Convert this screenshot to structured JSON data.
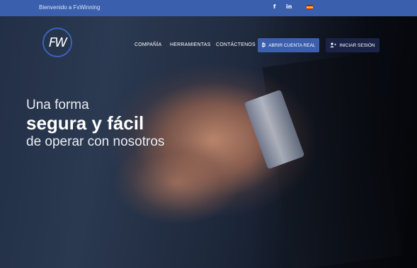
{
  "topbar": {
    "welcome": "Bienvenido a FxWinning",
    "facebook_icon": "f",
    "linkedin_icon": "in",
    "language_flag": "spain-flag-icon"
  },
  "header": {
    "logo_text": "FW",
    "nav": [
      "COMPAÑÍA",
      "HERRAMIENTAS",
      "CONTÁCTENOS"
    ],
    "open_account": {
      "icon": "bitcoin-icon",
      "icon_glyph": "₿",
      "label": "ABRIR CUENTA REAL"
    },
    "login": {
      "icon": "user-plus-icon",
      "icon_glyph": "👤",
      "label": "INICIAR SESIÓN"
    }
  },
  "hero": {
    "line1": "Una forma",
    "line2": "segura y fácil",
    "line3": "de operar con nosotros"
  },
  "colors": {
    "topbar": "#3a5fad",
    "primary_button": "#3a5fad",
    "secondary_button": "#1a2346"
  }
}
